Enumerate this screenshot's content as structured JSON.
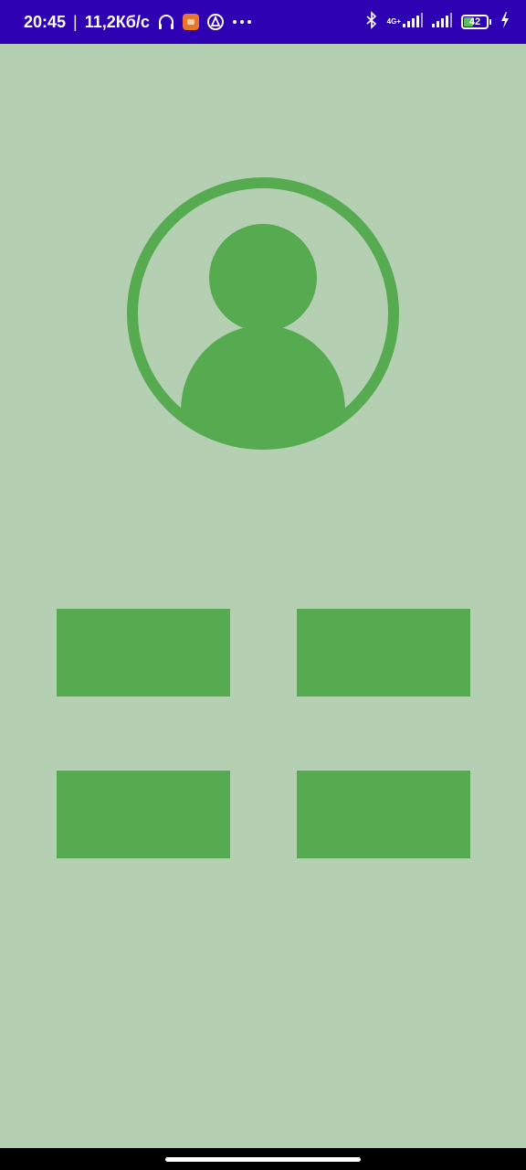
{
  "status_bar": {
    "time": "20:45",
    "separator": "|",
    "network_speed": "11,2Кб/с",
    "network_type": "4G+",
    "battery_level": "42",
    "battery_fraction": 0.42,
    "icons": [
      "headphones-icon",
      "app-notification-icon",
      "vpn-icon",
      "more-icon",
      "bluetooth-icon",
      "signal-icon",
      "signal-icon",
      "battery-icon",
      "charging-icon"
    ]
  },
  "colors": {
    "status_bar_bg": "#2e02b3",
    "background": "#b5cfb3",
    "accent_green": "#56ab50"
  },
  "avatar": {
    "icon": "user-avatar-icon"
  },
  "tiles": [
    {
      "label": ""
    },
    {
      "label": ""
    },
    {
      "label": ""
    },
    {
      "label": ""
    }
  ]
}
